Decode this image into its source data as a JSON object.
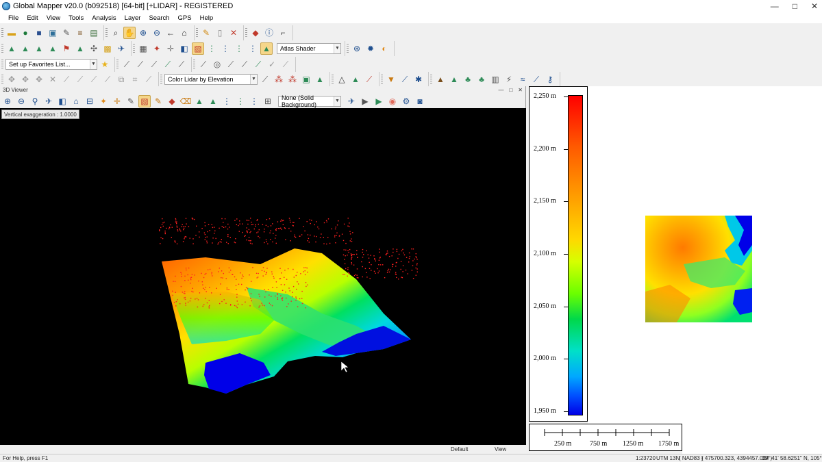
{
  "window": {
    "title": "Global Mapper v20.0 (b092518) [64-bit] [+LIDAR] - REGISTERED",
    "controls": [
      "—",
      "□",
      "✕"
    ]
  },
  "menu": [
    "File",
    "Edit",
    "View",
    "Tools",
    "Analysis",
    "Layer",
    "Search",
    "GPS",
    "Help"
  ],
  "toolbar": {
    "shader_combo": "Atlas Shader",
    "favorites_combo": "Set up Favorites List...",
    "lidar_color_combo": "Color Lidar by Elevation"
  },
  "viewer": {
    "title": "3D Viewer",
    "controls": [
      "—",
      "□",
      "✕"
    ],
    "background_combo": "None (Solid Background)",
    "vertical_exaggeration": "Vertical exaggeration : 1.0000",
    "status_left": "Default",
    "status_right": "View"
  },
  "legend": {
    "labels": [
      "2,250 m",
      "2,200 m",
      "2,150 m",
      "2,100 m",
      "2,050 m",
      "2,000 m",
      "1,950 m"
    ],
    "values": [
      2250,
      2200,
      2150,
      2100,
      2050,
      2000,
      1950
    ],
    "colors": {
      "high": "#ff0000",
      "mid_high": "#ff9f00",
      "mid": "#ffd800",
      "mid_low": "#00d84a",
      "low": "#0000e6"
    }
  },
  "scale_bar": {
    "labels": [
      "250 m",
      "750 m",
      "1250 m",
      "1750 m"
    ]
  },
  "status": {
    "help": "For Help, press F1",
    "scale": "1:23720",
    "projection": "UTM 13N",
    "datum": "( NAD83 )",
    "coords": "( 475700.323, 4394457.024 )",
    "latlon": "39° 41' 58.6251\" N, 105° 17'"
  }
}
